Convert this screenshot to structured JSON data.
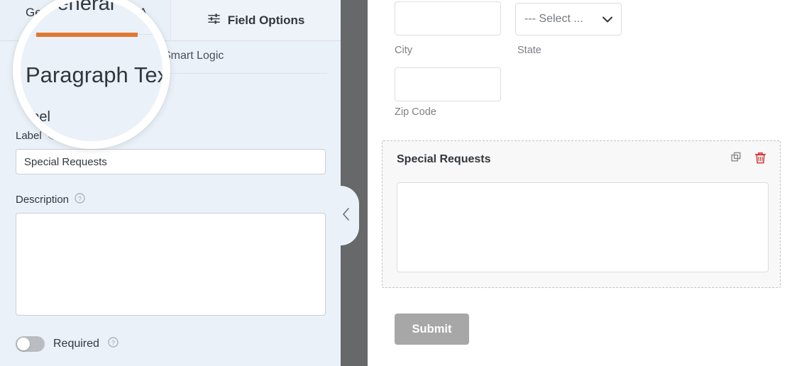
{
  "app": {
    "accent_orange": "#e27730",
    "panel_bg": "#eaf1f9",
    "divider_color": "#67686a",
    "delete_icon_color": "#d63638",
    "submit_button_color": "#a7a7a7"
  },
  "sidebar": {
    "tabs": [
      {
        "label": "General",
        "active": true
      },
      {
        "label": "A",
        "active": false
      }
    ],
    "field_options_tab": {
      "label": "Field Options",
      "icon": "sliders-icon"
    },
    "smart_logic_tab": {
      "label": "Smart Logic"
    },
    "heading": "Paragraph Text",
    "fields": {
      "label": {
        "label": "Label",
        "help_icon": "help-circle-icon",
        "value": "Special Requests"
      },
      "description": {
        "label": "Description",
        "help_icon": "help-circle-icon",
        "value": ""
      },
      "required": {
        "label": "Required",
        "help_icon": "help-circle-icon",
        "state": "off"
      }
    }
  },
  "divider": {
    "collapse_icon": "chevron-left-icon"
  },
  "preview": {
    "address_fields": [
      {
        "name": "city",
        "type": "text",
        "value": "",
        "sublabel": "City"
      },
      {
        "name": "state",
        "type": "select",
        "value": "--- Select ...",
        "sublabel": "State"
      },
      {
        "name": "zip",
        "type": "text",
        "value": "",
        "sublabel": "Zip Code"
      }
    ],
    "active_field": {
      "label": "Special Requests",
      "type": "textarea",
      "value": "",
      "actions": [
        {
          "name": "duplicate",
          "icon": "copy-icon"
        },
        {
          "name": "delete",
          "icon": "trash-icon"
        }
      ]
    },
    "submit_label": "Submit"
  },
  "magnifier": {
    "tab_general": "General",
    "tab_advanced": "A",
    "heading": "Paragraph Text",
    "label": "Label"
  }
}
